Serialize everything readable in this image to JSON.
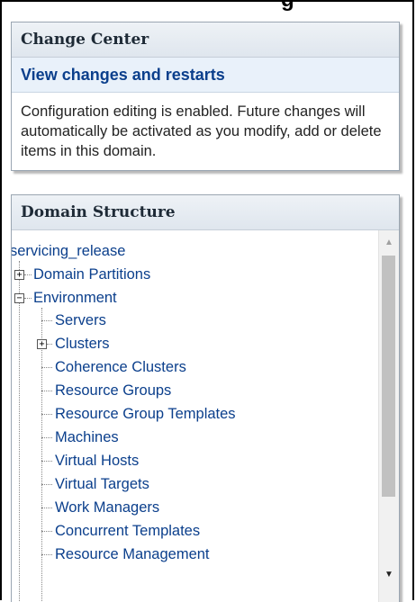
{
  "top_clipped_text": "g",
  "change_center": {
    "title": "Change Center",
    "link": "View changes and restarts",
    "message": "Configuration editing is enabled. Future changes will automatically be activated as you modify, add or delete items in this domain."
  },
  "domain_structure": {
    "title": "Domain Structure",
    "root": "servicing_release",
    "domain_partitions": "Domain Partitions",
    "environment": "Environment",
    "env_items": [
      "Servers",
      "Clusters",
      "Coherence Clusters",
      "Resource Groups",
      "Resource Group Templates",
      "Machines",
      "Virtual Hosts",
      "Virtual Targets",
      "Work Managers",
      "Concurrent Templates",
      "Resource Management"
    ]
  },
  "icons": {
    "expand": "plus-icon",
    "collapse": "minus-icon",
    "scroll_up": "arrow-up-icon",
    "scroll_down": "arrow-down-icon"
  },
  "colors": {
    "link": "#0b3f8c",
    "header_bg": "#dfe6ee",
    "link_row_bg": "#e9f1fa"
  }
}
